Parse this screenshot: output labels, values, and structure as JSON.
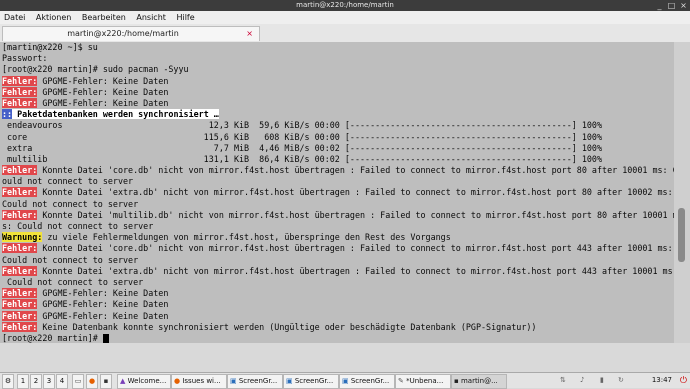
{
  "window": {
    "title": "martin@x220:/home/martin"
  },
  "menu": [
    "Datei",
    "Aktionen",
    "Bearbeiten",
    "Ansicht",
    "Hilfe"
  ],
  "tab": {
    "title": "martin@x220:/home/martin",
    "close": "×"
  },
  "terminal": {
    "lines": [
      [
        {
          "t": "[martin@x220 ~]$ su"
        }
      ],
      [
        {
          "t": "Passwort:"
        }
      ],
      [
        {
          "t": "[root@x220 martin]# sudo pacman -Syyu"
        }
      ],
      [
        {
          "t": "Fehler:",
          "c": "err"
        },
        {
          "t": " GPGME-Fehler: Keine Daten"
        }
      ],
      [
        {
          "t": "Fehler:",
          "c": "err"
        },
        {
          "t": " GPGME-Fehler: Keine Daten"
        }
      ],
      [
        {
          "t": "Fehler:",
          "c": "err"
        },
        {
          "t": " GPGME-Fehler: Keine Daten"
        }
      ],
      [
        {
          "t": "::",
          "c": "colon"
        },
        {
          "t": " Paketdatenbanken werden synchronisiert …",
          "c": "sync"
        }
      ],
      [
        {
          "t": " endeavouros                             12,3 KiB  59,6 KiB/s 00:00 [--------------------------------------------] 100%"
        }
      ],
      [
        {
          "t": " core                                   115,6 KiB   608 KiB/s 00:00 [--------------------------------------------] 100%"
        }
      ],
      [
        {
          "t": " extra                                    7,7 MiB  4,46 MiB/s 00:02 [--------------------------------------------] 100%"
        }
      ],
      [
        {
          "t": " multilib                               131,1 KiB  86,4 KiB/s 00:02 [--------------------------------------------] 100%"
        }
      ],
      [
        {
          "t": "Fehler:",
          "c": "err"
        },
        {
          "t": " Konnte Datei 'core.db' nicht von mirror.f4st.host übertragen : Failed to connect to mirror.f4st.host port 80 after 10001 ms: C"
        }
      ],
      [
        {
          "t": "ould not connect to server"
        }
      ],
      [
        {
          "t": "Fehler:",
          "c": "err"
        },
        {
          "t": " Konnte Datei 'extra.db' nicht von mirror.f4st.host übertragen : Failed to connect to mirror.f4st.host port 80 after 10002 ms:"
        }
      ],
      [
        {
          "t": "Could not connect to server"
        }
      ],
      [
        {
          "t": "Fehler:",
          "c": "err"
        },
        {
          "t": " Konnte Datei 'multilib.db' nicht von mirror.f4st.host übertragen : Failed to connect to mirror.f4st.host port 80 after 10001 m"
        }
      ],
      [
        {
          "t": "s: Could not connect to server"
        }
      ],
      [
        {
          "t": "Warnung:",
          "c": "warn"
        },
        {
          "t": " zu viele Fehlermeldungen von mirror.f4st.host, überspringe den Rest des Vorgangs"
        }
      ],
      [
        {
          "t": "Fehler:",
          "c": "err"
        },
        {
          "t": " Konnte Datei 'core.db' nicht von mirror.f4st.host übertragen : Failed to connect to mirror.f4st.host port 443 after 10001 ms:"
        }
      ],
      [
        {
          "t": "Could not connect to server"
        }
      ],
      [
        {
          "t": "Fehler:",
          "c": "err"
        },
        {
          "t": " Konnte Datei 'extra.db' nicht von mirror.f4st.host übertragen : Failed to connect to mirror.f4st.host port 443 after 10001 ms:"
        }
      ],
      [
        {
          "t": " Could not connect to server"
        }
      ],
      [
        {
          "t": "Fehler:",
          "c": "err"
        },
        {
          "t": " GPGME-Fehler: Keine Daten"
        }
      ],
      [
        {
          "t": "Fehler:",
          "c": "err"
        },
        {
          "t": " GPGME-Fehler: Keine Daten"
        }
      ],
      [
        {
          "t": "Fehler:",
          "c": "err"
        },
        {
          "t": " GPGME-Fehler: Keine Daten"
        }
      ],
      [
        {
          "t": "Fehler:",
          "c": "err"
        },
        {
          "t": " Keine Datenbank konnte synchronisiert werden (Ungültige oder beschädigte Datenbank (PGP-Signatur))"
        }
      ],
      [
        {
          "t": "[root@x220 martin]# "
        },
        {
          "cursor": true
        }
      ]
    ]
  },
  "taskbar": {
    "workspaces": [
      "1",
      "2",
      "3",
      "4"
    ],
    "items": [
      "Welcome...",
      "Issues wi...",
      "ScreenGr...",
      "ScreenGr...",
      "ScreenGr...",
      "*Unbena...",
      "martin@..."
    ],
    "clock": "13:47"
  }
}
